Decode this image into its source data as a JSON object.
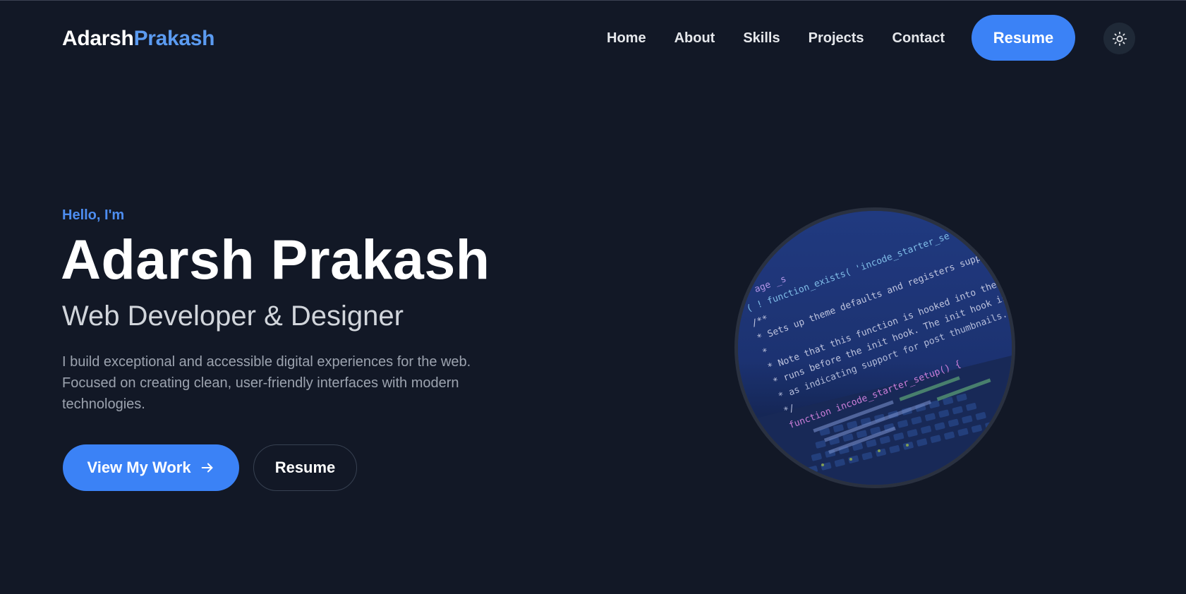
{
  "header": {
    "logo_first": "Adarsh",
    "logo_last": "Prakash",
    "nav": [
      {
        "label": "Home"
      },
      {
        "label": "About"
      },
      {
        "label": "Skills"
      },
      {
        "label": "Projects"
      },
      {
        "label": "Contact"
      }
    ],
    "resume_label": "Resume",
    "theme_icon": "sun-icon"
  },
  "hero": {
    "greeting": "Hello, I'm",
    "name": "Adarsh Prakash",
    "role": "Web Developer & Designer",
    "description": "I build exceptional and accessible digital experiences for the web. Focused on creating clean, user-friendly interfaces with modern technologies.",
    "primary_button": "View My Work",
    "primary_button_icon": "arrow-right-icon",
    "secondary_button": "Resume"
  },
  "profile_image": {
    "code_lines": [
      "age _s",
      "( ! function_exists( 'incode_starter_se",
      "/**",
      " * Sets up theme defaults and registers support",
      " *",
      " * Note that this function is hooked into the after",
      " * runs before the init hook. The init hook is too l",
      " * as indicating support for post thumbnails.",
      " */",
      "function incode_starter_setup() {"
    ]
  },
  "colors": {
    "background": "#121826",
    "accent": "#3b82f6",
    "accent_text": "#4d8df0",
    "logo_accent": "#5b9bf1"
  }
}
